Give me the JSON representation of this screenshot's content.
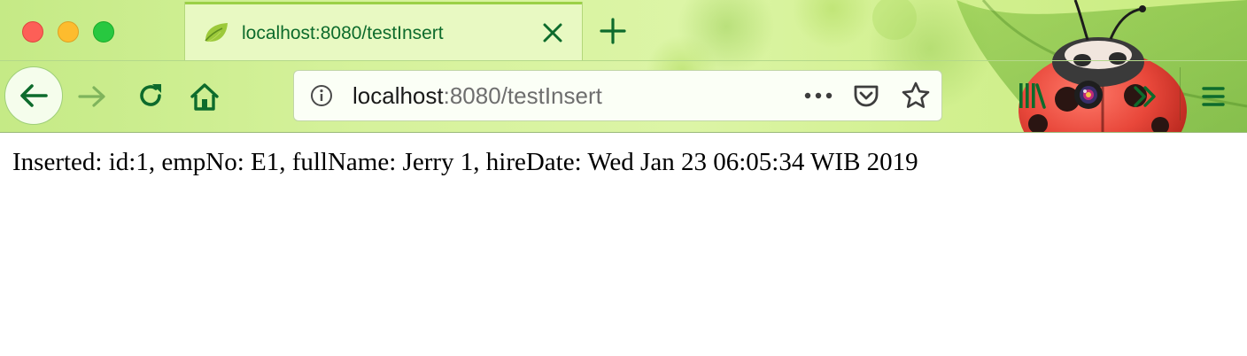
{
  "browser": {
    "tab": {
      "title": "localhost:8080/testInsert",
      "favicon": "spring-leaf-icon"
    },
    "url": {
      "host": "localhost",
      "rest": ":8080/testInsert"
    },
    "icons": {
      "back": "back-arrow-icon",
      "forward": "forward-arrow-icon",
      "reload": "reload-icon",
      "home": "home-icon",
      "info": "info-icon",
      "more": "more-actions-icon",
      "pocket": "pocket-icon",
      "bookmark": "star-icon",
      "library": "library-icon",
      "extension": "camera-extension-icon",
      "overflow": "overflow-chevron-icon",
      "menu": "hamburger-menu-icon"
    },
    "colors": {
      "theme_accent": "#0d6b2c",
      "theme_background": "#d6f29c",
      "close": "#fd5f57",
      "minimize": "#fdbc2e",
      "maximize": "#28c840"
    }
  },
  "page": {
    "text": "Inserted: id:1, empNo: E1, fullName: Jerry 1, hireDate: Wed Jan 23 06:05:34 WIB 2019"
  }
}
